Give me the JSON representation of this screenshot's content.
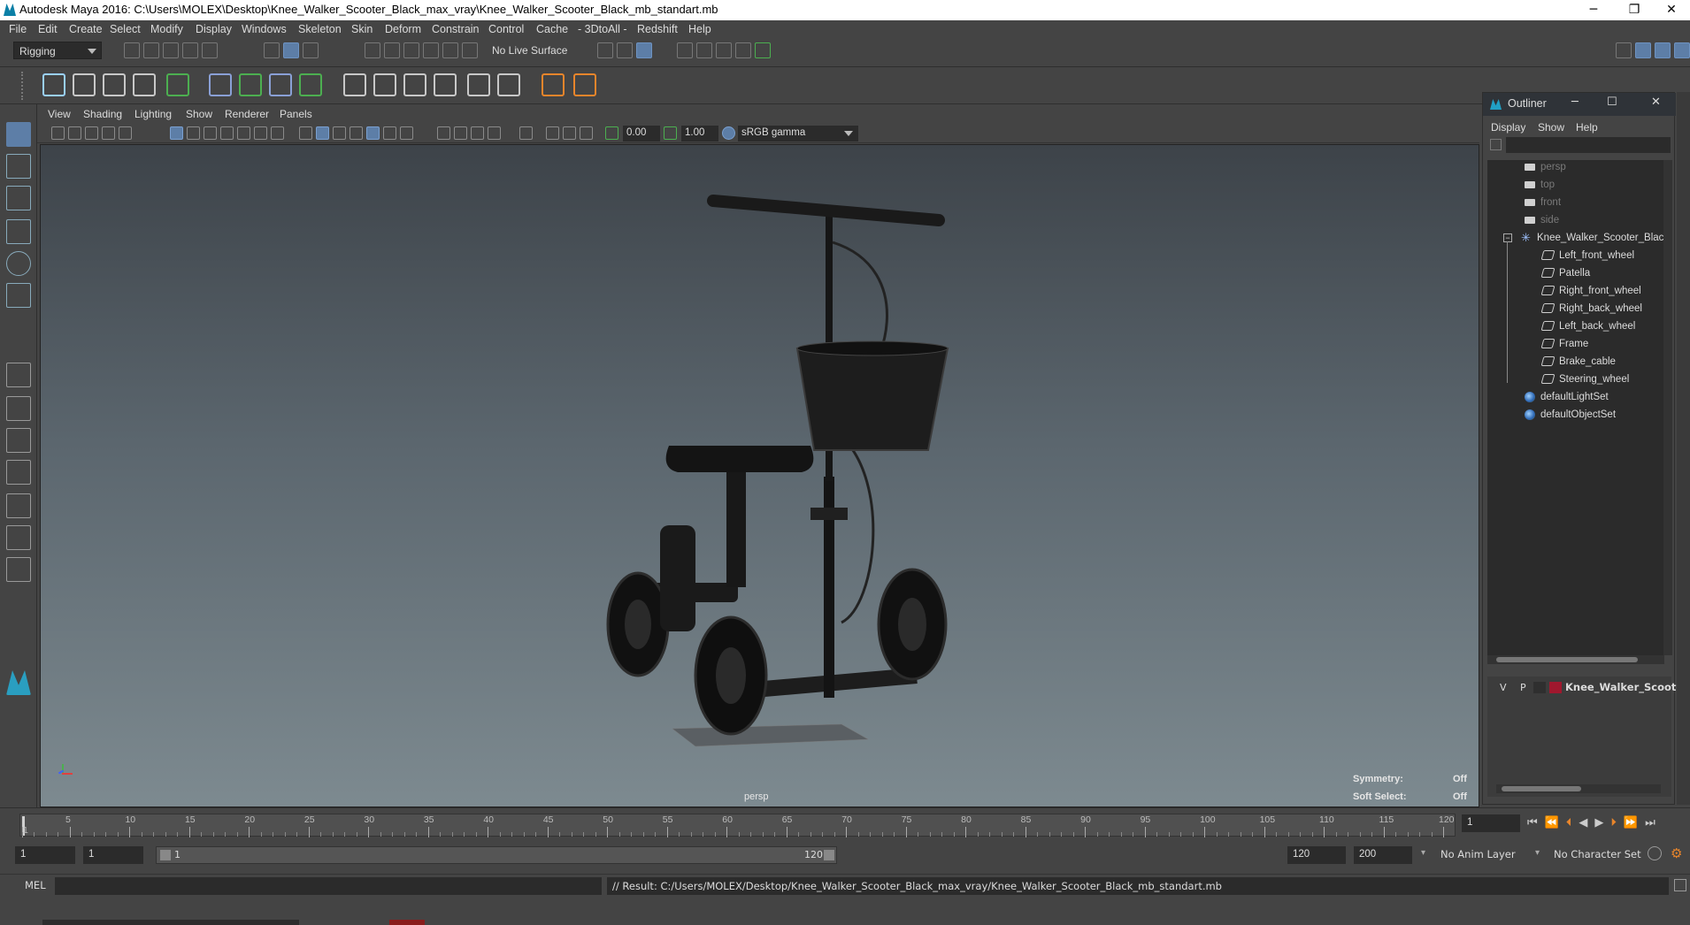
{
  "window": {
    "title": "Autodesk Maya 2016: C:\\Users\\MOLEX\\Desktop\\Knee_Walker_Scooter_Black_max_vray\\Knee_Walker_Scooter_Black_mb_standart.mb",
    "minimize": "─",
    "restore": "❐",
    "close": "✕"
  },
  "menubar": [
    "File",
    "Edit",
    "Create",
    "Select",
    "Modify",
    "Display",
    "Windows",
    "Skeleton",
    "Skin",
    "Deform",
    "Constrain",
    "Control",
    "Cache",
    "- 3DtoAll -",
    "Redshift",
    "Help"
  ],
  "statusline": {
    "mode": "Rigging",
    "live_surface": "No Live Surface"
  },
  "panel_menu": [
    "View",
    "Shading",
    "Lighting",
    "Show",
    "Renderer",
    "Panels"
  ],
  "panel_tools": {
    "exposure": "0.00",
    "gamma": "1.00",
    "color_space": "sRGB gamma"
  },
  "viewport": {
    "camera": "persp",
    "symmetry_label": "Symmetry:",
    "symmetry_value": "Off",
    "soft_select_label": "Soft Select:",
    "soft_select_value": "Off"
  },
  "outliner": {
    "title": "Outliner",
    "menu": [
      "Display",
      "Show",
      "Help"
    ],
    "cameras": [
      "persp",
      "top",
      "front",
      "side"
    ],
    "root": "Knee_Walker_Scooter_Black",
    "children": [
      "Left_front_wheel",
      "Patella",
      "Right_front_wheel",
      "Right_back_wheel",
      "Left_back_wheel",
      "Frame",
      "Brake_cable",
      "Steering_wheel"
    ],
    "sets": [
      "defaultLightSet",
      "defaultObjectSet"
    ],
    "layer": {
      "v": "V",
      "p": "P",
      "name": "Knee_Walker_Scooter_"
    },
    "colors": {
      "layer_swatch": "#a0182e"
    }
  },
  "timeslider": {
    "ticks": [
      "1",
      "5",
      "10",
      "15",
      "20",
      "25",
      "30",
      "35",
      "40",
      "45",
      "50",
      "55",
      "60",
      "65",
      "70",
      "75",
      "80",
      "85",
      "90",
      "95",
      "100",
      "105",
      "110",
      "115",
      "120"
    ],
    "current_frame": "1"
  },
  "range": {
    "start": "1",
    "current": "1",
    "slider_start": "1",
    "slider_end": "120",
    "end": "120",
    "max": "200",
    "anim_layer": "No Anim Layer",
    "char_set": "No Character Set"
  },
  "cmdline": {
    "lang": "MEL",
    "result": "// Result: C:/Users/MOLEX/Desktop/Knee_Walker_Scooter_Black_max_vray/Knee_Walker_Scooter_Black_mb_standart.mb"
  },
  "colors": {
    "accent": "#5d7ea7",
    "viewport_top": "#3d4349",
    "viewport_bottom": "#7d8a90"
  }
}
